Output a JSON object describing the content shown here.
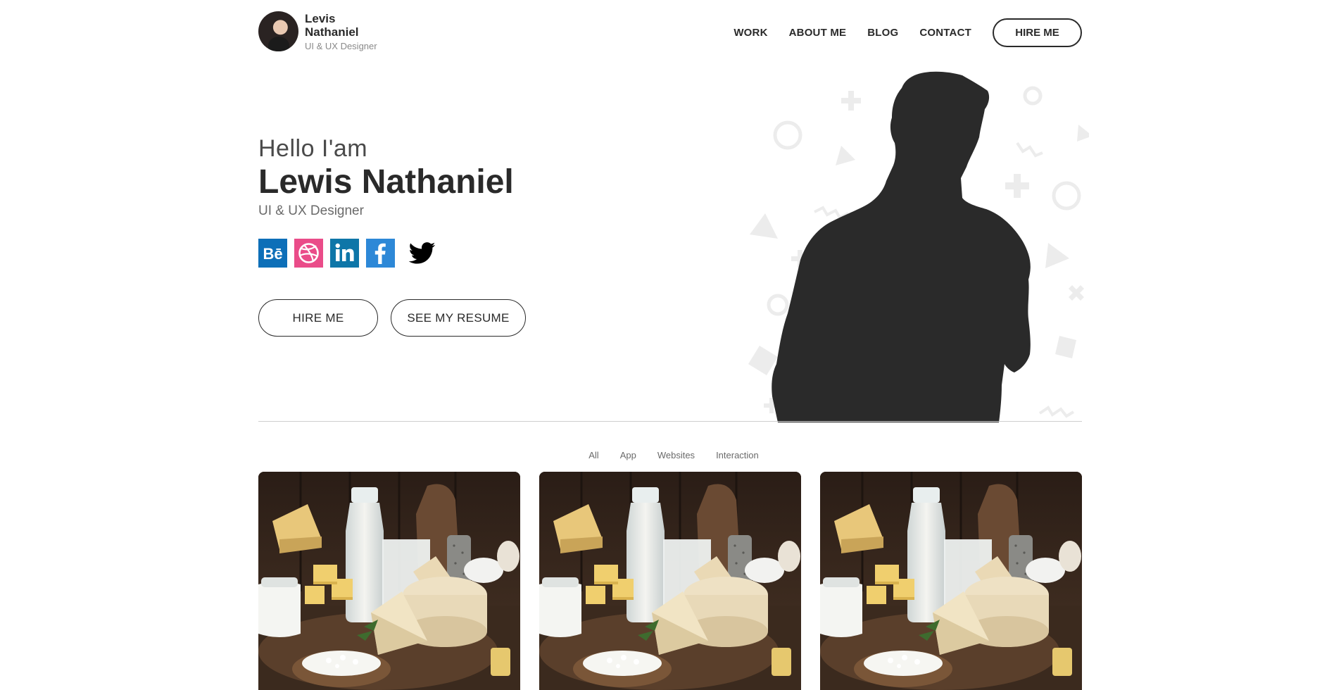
{
  "brand": {
    "name": "Levis Nathaniel",
    "role": "UI & UX Designer"
  },
  "nav": {
    "items": [
      {
        "label": "WORK"
      },
      {
        "label": "ABOUT ME"
      },
      {
        "label": "BLOG"
      },
      {
        "label": "CONTACT"
      }
    ],
    "hire_label": "HIRE ME"
  },
  "hero": {
    "greeting": "Hello I'am",
    "name": "Lewis Nathaniel",
    "role": "UI & UX Designer",
    "socials": [
      {
        "icon": "behance-icon",
        "color": "#0d6fb8"
      },
      {
        "icon": "dribbble-icon",
        "color": "#ea4c89"
      },
      {
        "icon": "linkedin-icon",
        "color": "#0e76a8"
      },
      {
        "icon": "facebook-icon",
        "color": "#2d88d7"
      },
      {
        "icon": "twitter-icon",
        "color": "#000000"
      }
    ],
    "hire_button": "HIRE ME",
    "resume_button": "SEE MY RESUME"
  },
  "filters": [
    {
      "label": "All"
    },
    {
      "label": "App"
    },
    {
      "label": "Websites"
    },
    {
      "label": "Interaction"
    }
  ],
  "portfolio": [
    {
      "image": "dairy-cheese-photo"
    },
    {
      "image": "dairy-cheese-photo"
    },
    {
      "image": "dairy-cheese-photo"
    }
  ],
  "colors": {
    "text": "#2a2a2a",
    "muted": "#8a8a8a",
    "silhouette": "#2a2a2a",
    "shapes": "#e9e9e9"
  }
}
